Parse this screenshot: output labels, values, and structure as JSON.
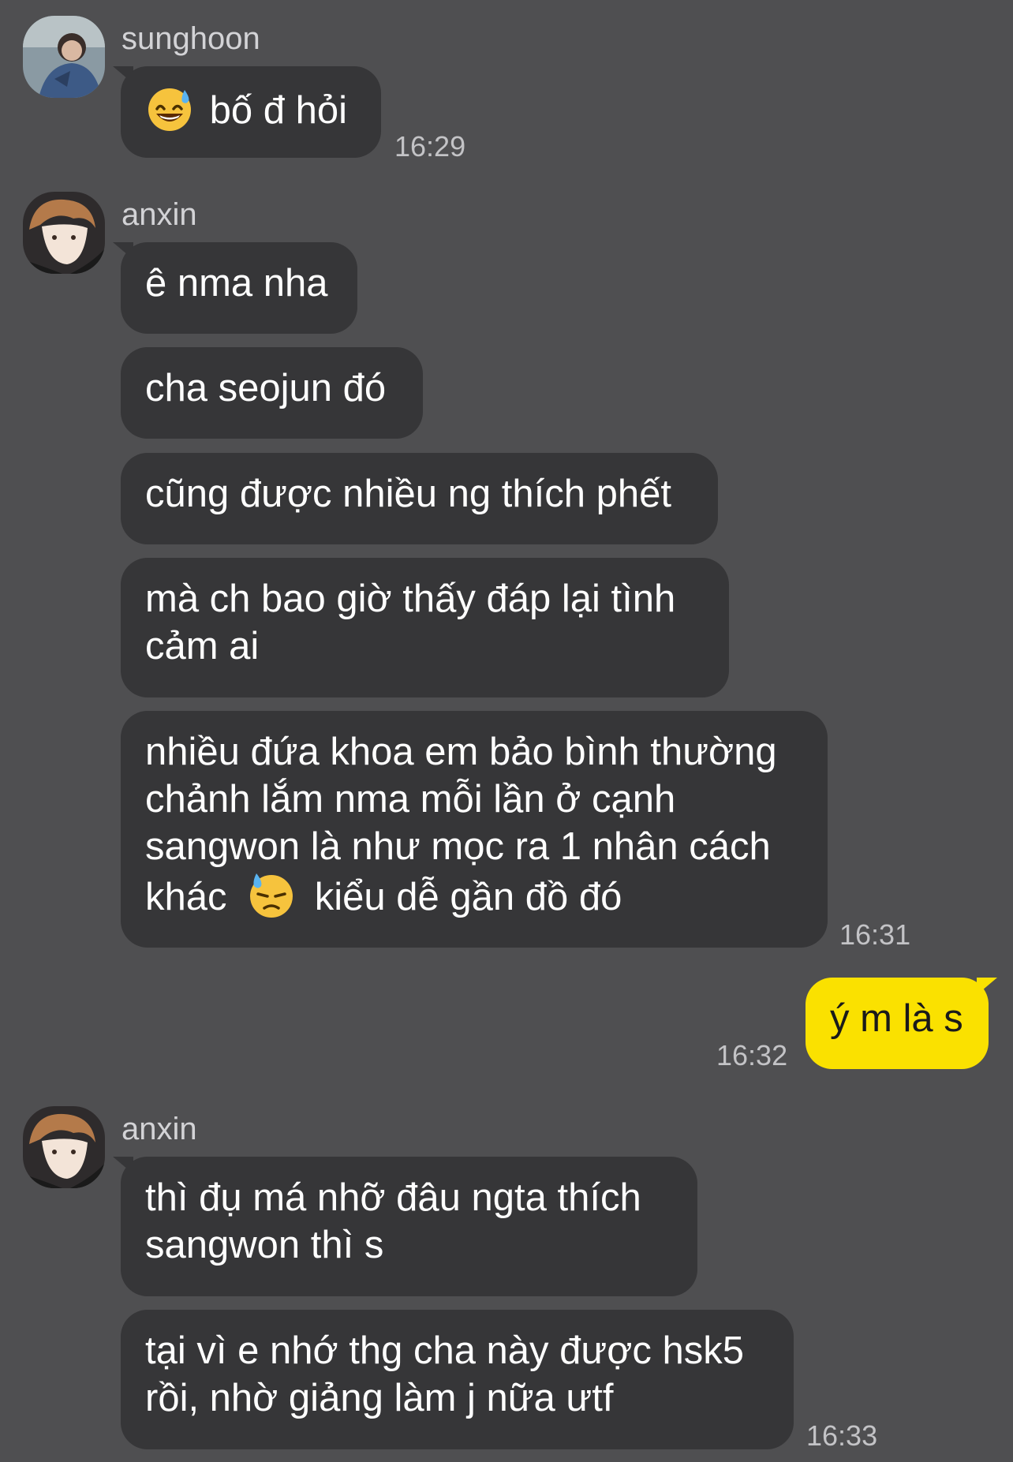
{
  "colors": {
    "background": "#4f4f51",
    "incoming_bubble": "#363638",
    "outgoing_bubble": "#fae100",
    "name_text": "#d3d3d6",
    "time_text": "#c3c3c6"
  },
  "group1": {
    "sender": "sunghoon",
    "avatar": "avatar-photo",
    "messages": [
      {
        "emoji": "sweat-smile-emoji",
        "text": "bố đ hỏi"
      }
    ],
    "time": "16:29"
  },
  "group2": {
    "sender": "anxin",
    "avatar": "avatar-photo",
    "messages": [
      {
        "lines": [
          "ê nma nha"
        ]
      },
      {
        "lines": [
          "cha seojun đó"
        ]
      },
      {
        "lines": [
          "cũng được nhiều ng thích phết"
        ]
      },
      {
        "lines": [
          "mà ch bao giờ thấy đáp lại tình",
          "cảm ai"
        ]
      },
      {
        "lines": [
          "nhiều đứa khoa em bảo bình thường",
          "chảnh lắm nma mỗi lần ở cạnh",
          "sangwon là như mọc ra 1 nhân cách"
        ],
        "last_line_before_emoji": "khác",
        "emoji": "downcast-sweat-emoji",
        "last_line_after_emoji": "kiểu dễ gần đồ đó"
      }
    ],
    "time": "16:31"
  },
  "outgoing": {
    "text": "ý m là s",
    "time": "16:32"
  },
  "group3": {
    "sender": "anxin",
    "avatar": "avatar-photo",
    "messages": [
      {
        "lines": [
          "thì đụ má nhỡ đâu ngta thích",
          "sangwon thì s"
        ]
      },
      {
        "lines": [
          "tại vì e nhớ thg cha này được hsk5",
          "rồi, nhờ giảng làm j nữa ưtf"
        ]
      }
    ],
    "time": "16:33"
  }
}
